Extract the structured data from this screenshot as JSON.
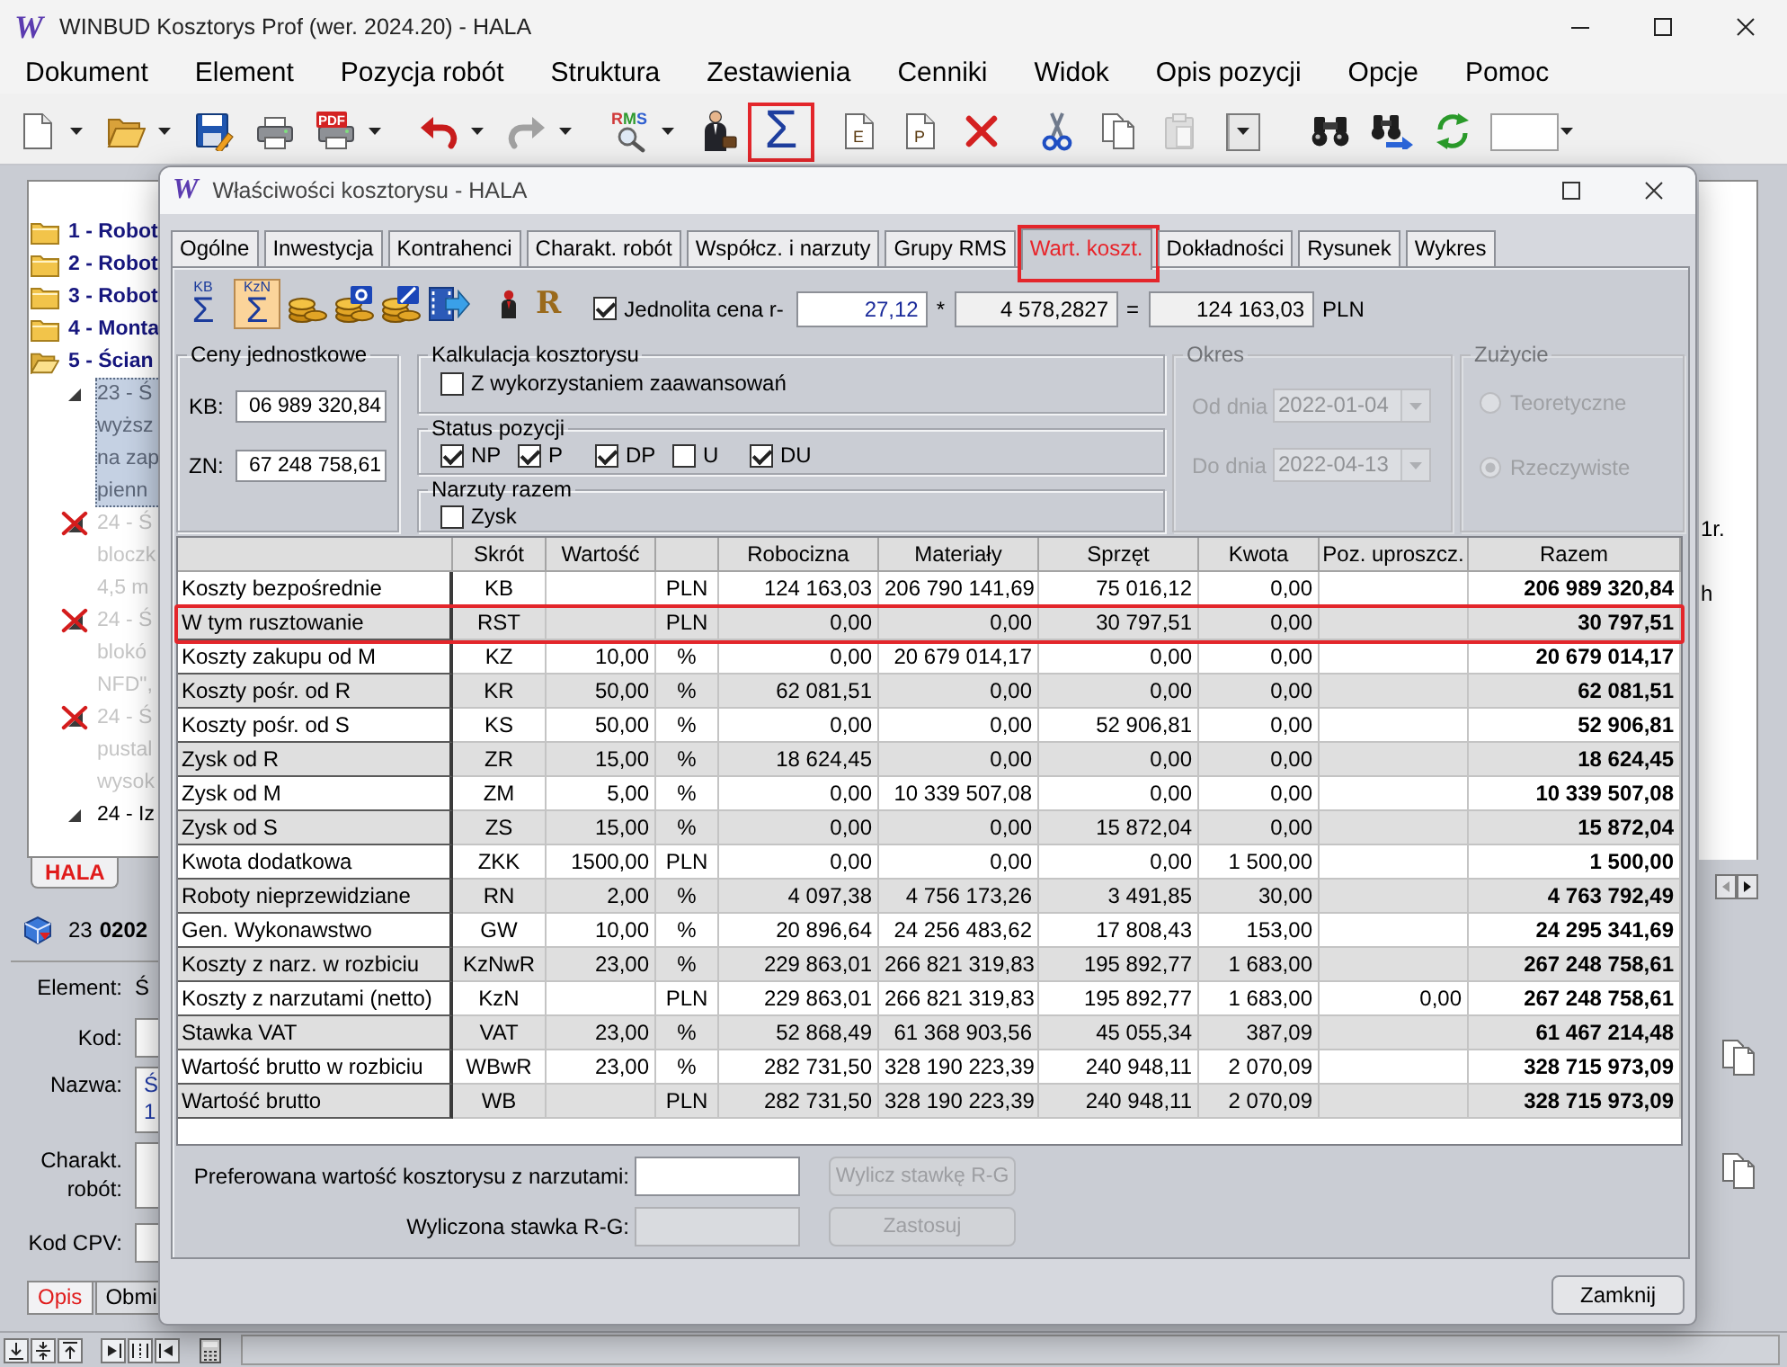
{
  "window": {
    "logo": "W",
    "title": "WINBUD Kosztorys Prof (wer. 2024.20) - HALA"
  },
  "menu": [
    "Dokument",
    "Element",
    "Pozycja robót",
    "Struktura",
    "Zestawienia",
    "Cenniki",
    "Widok",
    "Opis pozycji",
    "Opcje",
    "Pomoc"
  ],
  "toolbar": [
    [
      {
        "kind": "new",
        "dropdown": true,
        "disabled": false,
        "highlighted": false
      },
      {
        "kind": "open",
        "dropdown": true,
        "disabled": false,
        "highlighted": false
      },
      {
        "kind": "save",
        "dropdown": false,
        "disabled": false,
        "highlighted": false
      },
      {
        "kind": "print",
        "dropdown": false,
        "disabled": false,
        "highlighted": false
      },
      {
        "kind": "pdf",
        "label": "PDF",
        "dropdown": true,
        "disabled": false,
        "highlighted": false
      }
    ],
    [
      {
        "kind": "undo",
        "dropdown": true,
        "disabled": false,
        "highlighted": false
      },
      {
        "kind": "redo",
        "dropdown": true,
        "disabled": true,
        "highlighted": false
      }
    ],
    [
      {
        "kind": "rms",
        "label": "RMS",
        "dropdown": true,
        "disabled": false,
        "highlighted": false
      },
      {
        "kind": "person",
        "dropdown": false,
        "disabled": false,
        "highlighted": false
      },
      {
        "kind": "sum",
        "glyph": "Σ",
        "dropdown": false,
        "disabled": false,
        "highlighted": true
      }
    ],
    [
      {
        "kind": "doc",
        "label": "E",
        "dropdown": false,
        "disabled": false,
        "highlighted": false
      },
      {
        "kind": "doc",
        "label": "P",
        "dropdown": false,
        "disabled": false,
        "highlighted": false
      },
      {
        "kind": "delete",
        "dropdown": false,
        "disabled": false,
        "highlighted": false
      }
    ],
    [
      {
        "kind": "cut",
        "dropdown": false,
        "disabled": false,
        "highlighted": false
      },
      {
        "kind": "copy",
        "dropdown": false,
        "disabled": false,
        "highlighted": false
      },
      {
        "kind": "paste",
        "dropdown": false,
        "disabled": true,
        "highlighted": false
      }
    ],
    [
      {
        "kind": "combo",
        "dropdown": true,
        "disabled": false,
        "highlighted": false
      }
    ],
    [
      {
        "kind": "find",
        "dropdown": false,
        "disabled": false,
        "highlighted": false
      },
      {
        "kind": "find-next",
        "dropdown": false,
        "disabled": false,
        "highlighted": false
      },
      {
        "kind": "refresh",
        "dropdown": false,
        "disabled": false,
        "highlighted": false
      }
    ],
    [
      {
        "kind": "field",
        "dropdown": true,
        "disabled": false,
        "highlighted": false
      }
    ]
  ],
  "tree": {
    "items": [
      {
        "kind": "folder",
        "lines": [
          "1 - Robot"
        ],
        "selected": false,
        "disabled": false
      },
      {
        "kind": "folder",
        "lines": [
          "2 - Robot"
        ],
        "selected": false,
        "disabled": false
      },
      {
        "kind": "folder",
        "lines": [
          "3 - Robot"
        ],
        "selected": false,
        "disabled": false
      },
      {
        "kind": "folder",
        "lines": [
          "4 - Monta"
        ],
        "selected": false,
        "disabled": false
      },
      {
        "kind": "open-folder",
        "lines": [
          "5 - Ścian"
        ],
        "selected": false,
        "disabled": false,
        "children": [
          {
            "kind": "item",
            "lines": [
              "23 - Ś",
              "wyższ",
              "na zap",
              "pienn"
            ],
            "selected": true,
            "disabled": false
          },
          {
            "kind": "struck-item",
            "lines": [
              "24 - Ś",
              "bloczk",
              "4,5 m"
            ],
            "selected": false,
            "disabled": true
          },
          {
            "kind": "struck-item",
            "lines": [
              "24 - Ś",
              "blokó",
              "NFD\","
            ],
            "selected": false,
            "disabled": true
          },
          {
            "kind": "struck-item",
            "lines": [
              "24 - Ś",
              "pustal",
              "wysok"
            ],
            "selected": false,
            "disabled": true
          },
          {
            "kind": "item",
            "lines": [
              "24 - Iz"
            ],
            "selected": false,
            "disabled": false
          }
        ]
      }
    ],
    "tabs": [
      {
        "label": "HALA",
        "selected": true
      }
    ]
  },
  "current": {
    "number": "23",
    "code": "0202"
  },
  "form": [
    {
      "kind": "text",
      "label": "Element:",
      "value": "Ś"
    },
    {
      "kind": "input",
      "label": "Kod:"
    },
    {
      "kind": "memo",
      "label": "Nazwa:",
      "lines": [
        "Ś",
        "1"
      ]
    },
    {
      "kind": "memo",
      "label": "Charakt. robót:"
    },
    {
      "kind": "input",
      "label": "Kod CPV:"
    }
  ],
  "bottom_tabs": [
    {
      "label": "Opis",
      "selected": true
    },
    {
      "label": "Obmi",
      "selected": false
    }
  ],
  "right_panel": {
    "texts": [
      "1r.",
      "h"
    ]
  },
  "status_bar": {
    "tools": [
      [
        {
          "kind": "align-bottom"
        },
        {
          "kind": "align-middle"
        },
        {
          "kind": "align-top"
        }
      ],
      [
        {
          "kind": "align-right"
        },
        {
          "kind": "align-center"
        },
        {
          "kind": "align-left"
        }
      ],
      [
        {
          "kind": "calculator"
        }
      ]
    ]
  },
  "dialog": {
    "logo": "W",
    "title": "Właściwości kosztorysu - HALA",
    "tabs": [
      {
        "label": "Ogólne",
        "selected": false,
        "highlighted": false
      },
      {
        "label": "Inwestycja",
        "selected": false,
        "highlighted": false
      },
      {
        "label": "Kontrahenci",
        "selected": false,
        "highlighted": false
      },
      {
        "label": "Charakt. robót",
        "selected": false,
        "highlighted": false
      },
      {
        "label": "Współcz. i narzuty",
        "selected": false,
        "highlighted": false
      },
      {
        "label": "Grupy RMS",
        "selected": false,
        "highlighted": false
      },
      {
        "label": "Wart. koszt.",
        "selected": true,
        "highlighted": true
      },
      {
        "label": "Dokładności",
        "selected": false,
        "highlighted": false
      },
      {
        "label": "Rysunek",
        "selected": false,
        "highlighted": false
      },
      {
        "label": "Wykres",
        "selected": false,
        "highlighted": false
      }
    ],
    "tools": [
      [
        {
          "kind": "sum",
          "top": "KB",
          "glyph": "Σ",
          "pressed": false
        },
        {
          "kind": "sum",
          "top": "KzN",
          "glyph": "Σ",
          "pressed": true
        },
        {
          "kind": "coins",
          "pressed": false
        },
        {
          "kind": "coins-tile",
          "pressed": false
        },
        {
          "kind": "coins-slash",
          "pressed": false
        },
        {
          "kind": "film",
          "pressed": false
        }
      ],
      [
        {
          "kind": "figure",
          "pressed": false
        },
        {
          "kind": "letter",
          "glyph": "R",
          "pressed": false
        }
      ]
    ],
    "uniform_price": {
      "label": "Jednolita cena r-",
      "checked": true,
      "rate": "27,12",
      "times": "*",
      "hours": "4 578,2827",
      "equals": "=",
      "total": "124 163,03",
      "currency": "PLN"
    },
    "unit_prices": {
      "title": "Ceny jednostkowe",
      "fields": [
        {
          "label": "KB:",
          "value": "06 989 320,84"
        },
        {
          "label": "ZN:",
          "value": "67 248 758,61"
        }
      ]
    },
    "calculation": {
      "title": "Kalkulacja kosztorysu",
      "options": [
        {
          "label": "Z wykorzystaniem zaawansowań",
          "checked": false
        }
      ]
    },
    "position_status": {
      "title": "Status pozycji",
      "options": [
        {
          "label": "NP",
          "checked": true
        },
        {
          "label": "P",
          "checked": true
        },
        {
          "label": "DP",
          "checked": true
        },
        {
          "label": "U",
          "checked": false
        },
        {
          "label": "DU",
          "checked": true
        }
      ]
    },
    "markups_total": {
      "title": "Narzuty razem",
      "options": [
        {
          "label": "Zysk",
          "checked": false
        }
      ]
    },
    "period": {
      "title": "Okres",
      "disabled": true,
      "fields": [
        {
          "label": "Od dnia",
          "value": "2022-01-04"
        },
        {
          "label": "Do dnia",
          "value": "2022-04-13"
        }
      ]
    },
    "usage": {
      "title": "Zużycie",
      "disabled": true,
      "options": [
        {
          "label": "Teoretyczne",
          "selected": false
        },
        {
          "label": "Rzeczywiste",
          "selected": true
        }
      ]
    },
    "table": {
      "columns": [
        {
          "kind": "name"
        },
        {
          "label": "Skrót",
          "kind": "code"
        },
        {
          "label": "Wartość",
          "kind": "number"
        },
        {
          "kind": "code"
        },
        {
          "label": "Robocizna",
          "kind": "number"
        },
        {
          "label": "Materiały",
          "kind": "number"
        },
        {
          "label": "Sprzęt",
          "kind": "number"
        },
        {
          "label": "Kwota",
          "kind": "number"
        },
        {
          "label": "Poz. uproszcz.",
          "kind": "number"
        },
        {
          "label": "Razem",
          "kind": "total"
        }
      ],
      "rows": [
        {
          "cells": [
            "Koszty bezpośrednie",
            "KB",
            null,
            "PLN",
            "124 163,03",
            "206 790 141,69",
            "75 016,12",
            "0,00",
            null,
            "206 989 320,84"
          ],
          "highlighted": false
        },
        {
          "cells": [
            "W tym rusztowanie",
            "RST",
            null,
            "PLN",
            "0,00",
            "0,00",
            "30 797,51",
            "0,00",
            null,
            "30 797,51"
          ],
          "highlighted": true
        },
        {
          "cells": [
            "Koszty zakupu od M",
            "KZ",
            "10,00",
            "%",
            "0,00",
            "20 679 014,17",
            "0,00",
            "0,00",
            null,
            "20 679 014,17"
          ],
          "highlighted": false
        },
        {
          "cells": [
            "Koszty pośr. od R",
            "KR",
            "50,00",
            "%",
            "62 081,51",
            "0,00",
            "0,00",
            "0,00",
            null,
            "62 081,51"
          ],
          "highlighted": false
        },
        {
          "cells": [
            "Koszty pośr. od S",
            "KS",
            "50,00",
            "%",
            "0,00",
            "0,00",
            "52 906,81",
            "0,00",
            null,
            "52 906,81"
          ],
          "highlighted": false
        },
        {
          "cells": [
            "Zysk od R",
            "ZR",
            "15,00",
            "%",
            "18 624,45",
            "0,00",
            "0,00",
            "0,00",
            null,
            "18 624,45"
          ],
          "highlighted": false
        },
        {
          "cells": [
            "Zysk od M",
            "ZM",
            "5,00",
            "%",
            "0,00",
            "10 339 507,08",
            "0,00",
            "0,00",
            null,
            "10 339 507,08"
          ],
          "highlighted": false
        },
        {
          "cells": [
            "Zysk od S",
            "ZS",
            "15,00",
            "%",
            "0,00",
            "0,00",
            "15 872,04",
            "0,00",
            null,
            "15 872,04"
          ],
          "highlighted": false
        },
        {
          "cells": [
            "Kwota dodatkowa",
            "ZKK",
            "1500,00",
            "PLN",
            "0,00",
            "0,00",
            "0,00",
            "1 500,00",
            null,
            "1 500,00"
          ],
          "highlighted": false
        },
        {
          "cells": [
            "Roboty nieprzewidziane",
            "RN",
            "2,00",
            "%",
            "4 097,38",
            "4 756 173,26",
            "3 491,85",
            "30,00",
            null,
            "4 763 792,49"
          ],
          "highlighted": false
        },
        {
          "cells": [
            "Gen. Wykonawstwo",
            "GW",
            "10,00",
            "%",
            "20 896,64",
            "24 256 483,62",
            "17 808,43",
            "153,00",
            null,
            "24 295 341,69"
          ],
          "highlighted": false
        },
        {
          "cells": [
            "Koszty z narz. w rozbiciu",
            "KzNwR",
            "23,00",
            "%",
            "229 863,01",
            "266 821 319,83",
            "195 892,77",
            "1 683,00",
            null,
            "267 248 758,61"
          ],
          "highlighted": false
        },
        {
          "cells": [
            "Koszty z narzutami (netto)",
            "KzN",
            null,
            "PLN",
            "229 863,01",
            "266 821 319,83",
            "195 892,77",
            "1 683,00",
            "0,00",
            "267 248 758,61"
          ],
          "highlighted": false
        },
        {
          "cells": [
            "Stawka VAT",
            "VAT",
            "23,00",
            "%",
            "52 868,49",
            "61 368 903,56",
            "45 055,34",
            "387,09",
            null,
            "61 467 214,48"
          ],
          "highlighted": false
        },
        {
          "cells": [
            "Wartość brutto w rozbiciu",
            "WBwR",
            "23,00",
            "%",
            "282 731,50",
            "328 190 223,39",
            "240 948,11",
            "2 070,09",
            null,
            "328 715 973,09"
          ],
          "highlighted": false
        },
        {
          "cells": [
            "Wartość brutto",
            "WB",
            null,
            "PLN",
            "282 731,50",
            "328 190 223,39",
            "240 948,11",
            "2 070,09",
            null,
            "328 715 973,09"
          ],
          "highlighted": false
        }
      ]
    },
    "preferred": {
      "label": "Preferowana wartość kosztorysu z narzutami:",
      "field_disabled": false,
      "button": "Wylicz stawkę R-G",
      "button_disabled": true
    },
    "computed": {
      "label": "Wyliczona stawka R-G:",
      "field_disabled": true,
      "button": "Zastosuj",
      "button_disabled": true
    },
    "close_button": "Zamknij"
  }
}
